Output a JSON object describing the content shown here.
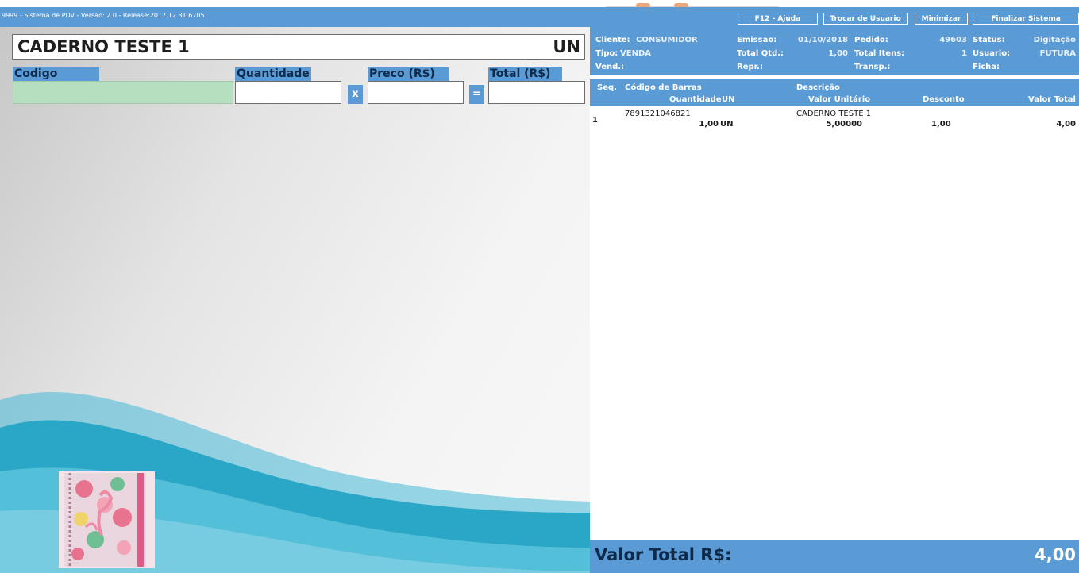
{
  "window": {
    "title": "9999 - Sistema de PDV - Versao: 2.0 - Release:2017.12.31.6705"
  },
  "toolbar": {
    "help_label": "F12 - Ajuda",
    "switch_user_label": "Trocar de Usuario",
    "minimize_label": "Minimizar",
    "exit_label": "Finalizar Sistema"
  },
  "product": {
    "name": "CADERNO TESTE 1",
    "unit": "UN"
  },
  "entry": {
    "code_label": "Codigo",
    "quantity_label": "Quantidade",
    "price_label": "Preco (R$)",
    "total_label": "Total (R$)",
    "code_value": "",
    "quantity_value": "",
    "price_value": "",
    "total_value": "",
    "times_symbol": "x",
    "equals_symbol": "="
  },
  "sale_info": {
    "cliente_label": "Cliente:",
    "cliente_value": "CONSUMIDOR",
    "tipo_label": "Tipo:",
    "tipo_value": "VENDA",
    "vend_label": "Vend.:",
    "emissao_label": "Emissao:",
    "emissao_value": "01/10/2018",
    "total_qtd_label": "Total Qtd.:",
    "total_qtd_value": "1,00",
    "repr_label": "Repr.:",
    "pedido_label": "Pedido:",
    "pedido_value": "49603",
    "total_itens_label": "Total Itens:",
    "total_itens_value": "1",
    "transp_label": "Transp.:",
    "status_label": "Status:",
    "status_value": "Digitação",
    "usuario_label": "Usuario:",
    "usuario_value": "FUTURA",
    "ficha_label": "Ficha:"
  },
  "grid": {
    "headers": {
      "seq": "Seq.",
      "barcode": "Código de Barras",
      "description": "Descrição",
      "quantity": "Quantidade",
      "unit": "UN",
      "unit_price": "Valor Unitário",
      "discount": "Desconto",
      "total": "Valor Total"
    },
    "rows": [
      {
        "seq": "1",
        "barcode": "7891321046821",
        "description": "CADERNO TESTE 1",
        "quantity": "1,00",
        "unit": "UN",
        "unit_price": "5,00000",
        "discount": "1,00",
        "total": "4,00"
      }
    ]
  },
  "footer": {
    "total_label": "Valor Total R$:",
    "total_value": "4,00"
  },
  "colors": {
    "accent": "#5b9bd5",
    "code_field": "#b6dfbf",
    "wave": "#2aa6c6"
  }
}
